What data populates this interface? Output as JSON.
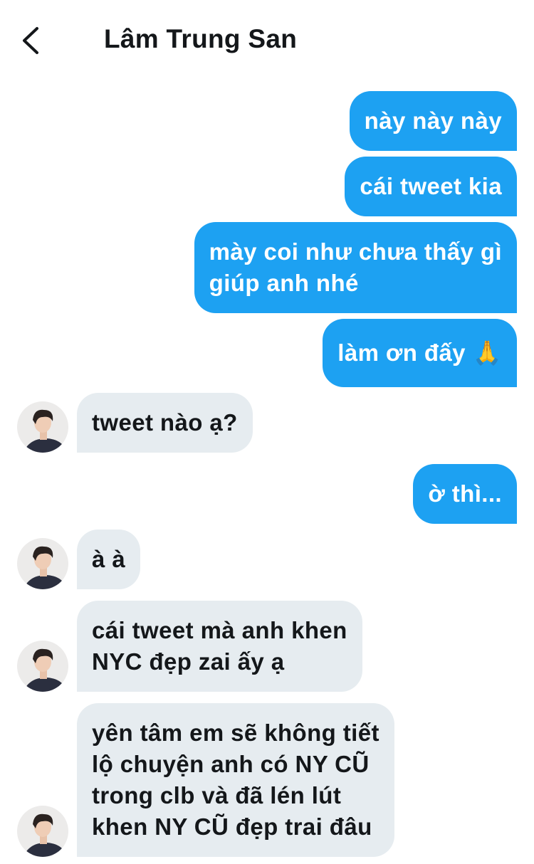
{
  "header": {
    "back_icon": "chevron-left-icon",
    "title": "Lâm Trung San"
  },
  "messages": [
    {
      "direction": "outgoing",
      "text": "này này này"
    },
    {
      "direction": "outgoing",
      "text": "cái tweet kia"
    },
    {
      "direction": "outgoing",
      "text": "mày coi như chưa thấy gì\ngiúp anh nhé"
    },
    {
      "direction": "outgoing",
      "text": "làm ơn đấy 🙏"
    },
    {
      "direction": "incoming",
      "text": "tweet nào ạ?"
    },
    {
      "direction": "outgoing",
      "text": "ờ thì..."
    },
    {
      "direction": "incoming",
      "text": "à à"
    },
    {
      "direction": "incoming",
      "text": "cái tweet mà anh khen\nNYC đẹp zai ấy ạ"
    },
    {
      "direction": "incoming",
      "text": "yên tâm em sẽ không tiết\nlộ chuyện anh có NY CŨ\ntrong clb và đã lén lút\nkhen NY CŨ đẹp trai đâu"
    }
  ],
  "colors": {
    "outgoing_bubble": "#1da1f2",
    "incoming_bubble": "#e6ecf0",
    "title_text": "#14171a"
  }
}
